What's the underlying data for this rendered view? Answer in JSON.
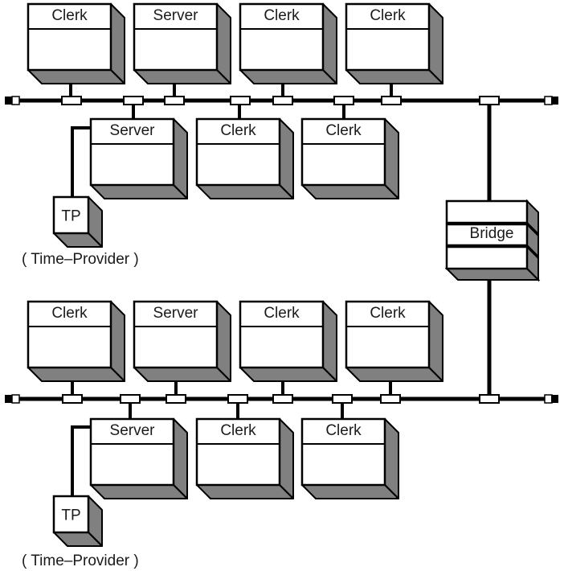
{
  "colors": {
    "line": "#000000",
    "face": "#ffffff",
    "shade": "#808080"
  },
  "networks": [
    {
      "upper_nodes": [
        {
          "label": "Clerk",
          "type": "clerk"
        },
        {
          "label": "Server",
          "type": "server"
        },
        {
          "label": "Clerk",
          "type": "clerk"
        },
        {
          "label": "Clerk",
          "type": "clerk"
        }
      ],
      "lower_nodes": [
        {
          "label": "Server",
          "type": "server"
        },
        {
          "label": "Clerk",
          "type": "clerk"
        },
        {
          "label": "Clerk",
          "type": "clerk"
        }
      ],
      "time_provider": {
        "label": "TP",
        "caption": "( Time–Provider )"
      }
    },
    {
      "upper_nodes": [
        {
          "label": "Clerk",
          "type": "clerk"
        },
        {
          "label": "Server",
          "type": "server"
        },
        {
          "label": "Clerk",
          "type": "clerk"
        },
        {
          "label": "Clerk",
          "type": "clerk"
        }
      ],
      "lower_nodes": [
        {
          "label": "Server",
          "type": "server"
        },
        {
          "label": "Clerk",
          "type": "clerk"
        },
        {
          "label": "Clerk",
          "type": "clerk"
        }
      ],
      "time_provider": {
        "label": "TP",
        "caption": "( Time–Provider )"
      }
    }
  ],
  "bridge": {
    "label": "Bridge"
  }
}
